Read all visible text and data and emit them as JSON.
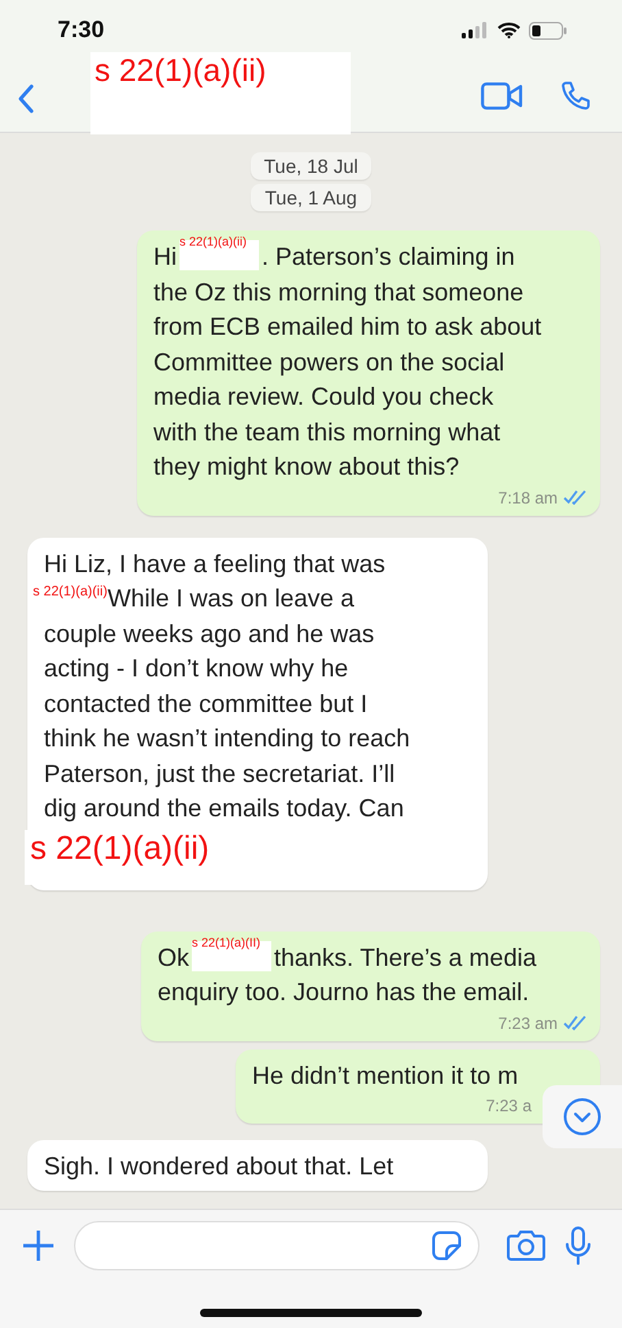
{
  "status_bar": {
    "time": "7:30"
  },
  "header": {
    "redaction": "s 22(1)(a)(ii)"
  },
  "date_chips": [
    "Tue, 18 Jul",
    "Tue, 1 Aug"
  ],
  "messages": [
    {
      "kind": "outgoing",
      "read": true,
      "time": "7:18 am",
      "lines": [
        [
          {
            "kind": "text",
            "text": "Hi"
          },
          {
            "kind": "redaction",
            "text": "s 22(1)(a)(ii)"
          },
          {
            "kind": "text",
            "text": ". Paterson’s claiming in"
          }
        ],
        [
          {
            "kind": "text",
            "text": "the Oz this morning that someone"
          }
        ],
        [
          {
            "kind": "text",
            "text": "from ECB emailed him to ask about"
          }
        ],
        [
          {
            "kind": "text",
            "text": "Committee powers on the social"
          }
        ],
        [
          {
            "kind": "text",
            "text": "media review. Could you check"
          }
        ],
        [
          {
            "kind": "text",
            "text": "with the team this morning what"
          }
        ],
        [
          {
            "kind": "text",
            "text": "they might know about this?"
          }
        ]
      ]
    },
    {
      "kind": "incoming",
      "lines": [
        [
          {
            "kind": "text",
            "text": "Hi Liz, I have a feeling that was"
          }
        ],
        [
          {
            "kind": "redaction_label",
            "text": "s 22(1)(a)(ii)"
          },
          {
            "kind": "text",
            "text": "While I was on leave a"
          }
        ],
        [
          {
            "kind": "text",
            "text": "couple weeks ago and he was"
          }
        ],
        [
          {
            "kind": "text",
            "text": "acting - I don’t know why he"
          }
        ],
        [
          {
            "kind": "text",
            "text": "contacted the committee but I"
          }
        ],
        [
          {
            "kind": "text",
            "text": "think he wasn’t intending to reach"
          }
        ],
        [
          {
            "kind": "text",
            "text": "Paterson, just the secretariat.  I’ll"
          }
        ],
        [
          {
            "kind": "text",
            "text": "dig around the emails today.  Can"
          }
        ],
        [
          {
            "kind": "redaction_block",
            "text": "s 22(1)(a)(ii)"
          }
        ]
      ]
    },
    {
      "kind": "outgoing",
      "read": true,
      "time": "7:23 am",
      "lines": [
        [
          {
            "kind": "text",
            "text": "Ok"
          },
          {
            "kind": "redaction",
            "text": "s 22(1)(a)(II)"
          },
          {
            "kind": "text",
            "text": "thanks. There’s a media"
          }
        ],
        [
          {
            "kind": "text",
            "text": "enquiry too. Journo has the email."
          }
        ]
      ]
    },
    {
      "kind": "outgoing",
      "read": false,
      "time": "7:23 a",
      "lines": [
        [
          {
            "kind": "text",
            "text": "He didn’t mention it to m"
          }
        ]
      ]
    },
    {
      "kind": "incoming",
      "lines": [
        [
          {
            "kind": "text",
            "text": "Sigh. I wondered about that. Let"
          }
        ]
      ]
    }
  ]
}
